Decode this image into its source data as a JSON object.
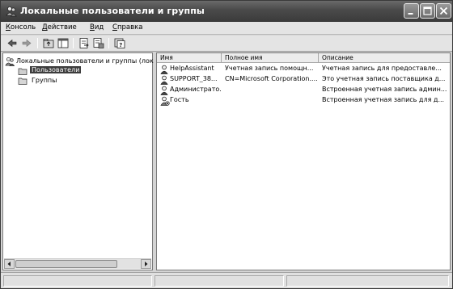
{
  "window": {
    "title": "Локальные пользователи и группы"
  },
  "menu": [
    {
      "label": "Консоль",
      "underline": "К",
      "rest": "онсоль"
    },
    {
      "label": "Действие",
      "underline": "Д",
      "rest": "ействие"
    },
    {
      "label": "Вид",
      "underline": "В",
      "rest": "ид"
    },
    {
      "label": "Справка",
      "underline": "С",
      "rest": "правка"
    }
  ],
  "toolbar": {
    "buttons": [
      "back-arrow-icon",
      "forward-arrow-icon",
      "up-folder-icon",
      "show-hide-tree-icon",
      "export-list-icon",
      "properties-icon",
      "help-icon"
    ]
  },
  "tree": {
    "root": "Локальные пользователи и группы (лок",
    "users": "Пользователи",
    "groups": "Группы"
  },
  "list": {
    "columns": [
      "Имя",
      "Полное имя",
      "Описание"
    ],
    "rows": [
      {
        "name": "HelpAssistant",
        "full_name": "Учетная запись помощн...",
        "description": "Учетная запись для предоставле..."
      },
      {
        "name": "SUPPORT_38...",
        "full_name": "CN=Microsoft Corporation....",
        "description": "Это учетная запись поставщика д..."
      },
      {
        "name": "Администрато...",
        "full_name": "",
        "description": "Встроенная учетная запись админ..."
      },
      {
        "name": "Гость",
        "full_name": "",
        "description": "Встроенная учетная запись для д..."
      }
    ]
  }
}
